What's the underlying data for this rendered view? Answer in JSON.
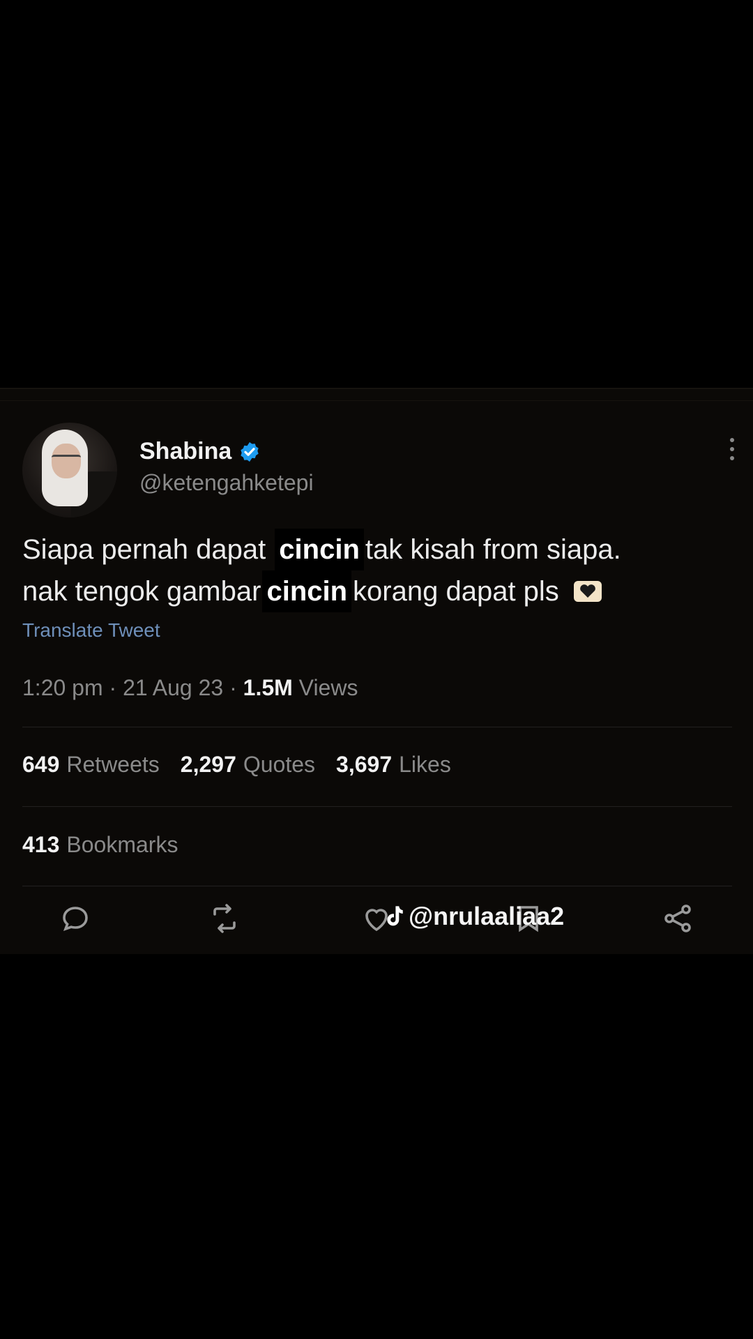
{
  "tweet": {
    "author_name": "Shabina",
    "handle": "@ketengahketepi",
    "text_part1": "Siapa pernah dapat ",
    "overlay_word_1": "cincin",
    "text_part2": "tak kisah from siapa.",
    "text_part3": "nak tengok gambar",
    "overlay_word_2": "cincin",
    "text_part4": "korang dapat pls",
    "translate_label": "Translate Tweet",
    "time": "1:20 pm",
    "date": "21 Aug 23",
    "views_count": "1.5M",
    "views_label": "Views"
  },
  "stats": {
    "retweets_count": "649",
    "retweets_label": "Retweets",
    "quotes_count": "2,297",
    "quotes_label": "Quotes",
    "likes_count": "3,697",
    "likes_label": "Likes",
    "bookmarks_count": "413",
    "bookmarks_label": "Bookmarks"
  },
  "watermark": {
    "text": "@nrulaaliaa2",
    "icon": "tiktok-icon"
  },
  "colors": {
    "background": "#000000",
    "card": "#0b0907",
    "link": "#6e8fb9",
    "verified": "#1d9bf0"
  }
}
